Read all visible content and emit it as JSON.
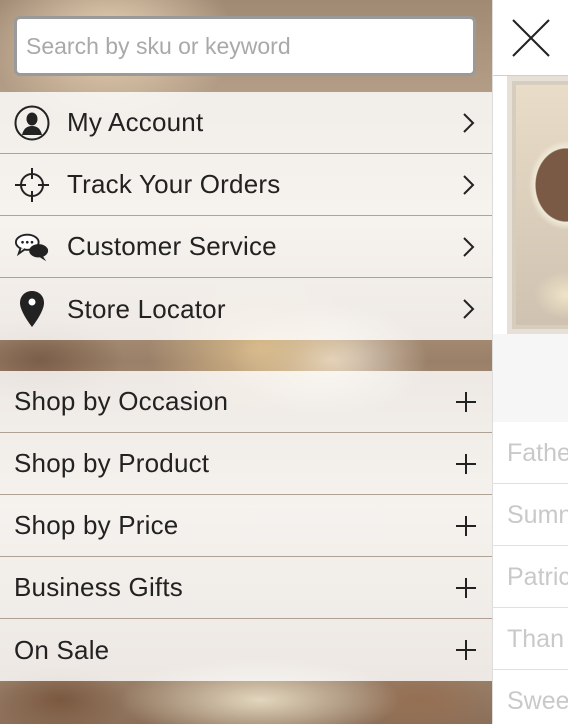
{
  "search": {
    "placeholder": "Search by sku or keyword"
  },
  "account_menu": [
    {
      "label": "My Account",
      "icon": "account-icon"
    },
    {
      "label": "Track Your Orders",
      "icon": "crosshair-icon"
    },
    {
      "label": "Customer Service",
      "icon": "chat-bubbles-icon"
    },
    {
      "label": "Store Locator",
      "icon": "map-pin-icon"
    }
  ],
  "category_menu": [
    {
      "label": "Shop by Occasion"
    },
    {
      "label": "Shop by Product"
    },
    {
      "label": "Shop by Price"
    },
    {
      "label": "Business Gifts"
    },
    {
      "label": "On Sale"
    }
  ],
  "background_page": {
    "list_items": [
      "Fathe",
      "Sumn",
      "Patric",
      "Than",
      "Swee"
    ]
  }
}
